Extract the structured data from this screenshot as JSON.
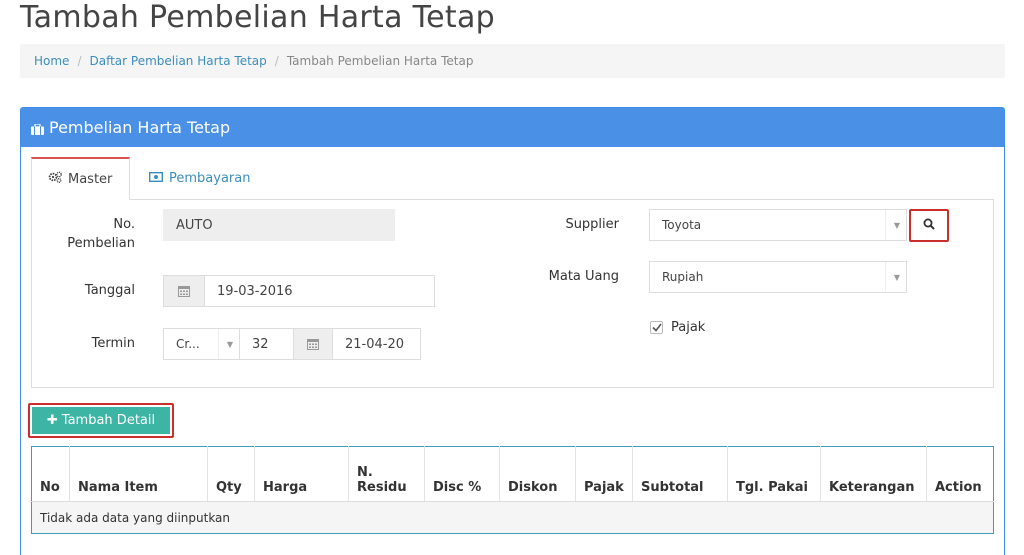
{
  "page": {
    "title": "Tambah Pembelian Harta Tetap"
  },
  "breadcrumb": {
    "home": "Home",
    "list": "Daftar Pembelian Harta Tetap",
    "current": "Tambah Pembelian Harta Tetap"
  },
  "panel": {
    "title": "Pembelian Harta Tetap",
    "tabs": [
      {
        "label": "Master",
        "icon": "gears-icon"
      },
      {
        "label": "Pembayaran",
        "icon": "money-icon"
      }
    ]
  },
  "form": {
    "no_pembelian_label_1": "No.",
    "no_pembelian_label_2": "Pembelian",
    "no_pembelian_value": "AUTO",
    "tanggal_label": "Tanggal",
    "tanggal_value": "19-03-2016",
    "termin_label": "Termin",
    "termin_type_value": "Cr...",
    "termin_days_value": "32",
    "termin_date_value": "21-04-20",
    "supplier_label": "Supplier",
    "supplier_value": "Toyota",
    "mata_uang_label": "Mata Uang",
    "mata_uang_value": "Rupiah",
    "pajak_label": "Pajak",
    "pajak_checked": true
  },
  "detail": {
    "add_button_label": "Tambah Detail",
    "columns": [
      "No",
      "Nama Item",
      "Qty",
      "Harga",
      "N. Residu",
      "Disc %",
      "Diskon",
      "Pajak",
      "Subtotal",
      "Tgl. Pakai",
      "Keterangan",
      "Action"
    ],
    "n_residu_line1": "N.",
    "n_residu_line2": "Residu",
    "empty_text": "Tidak ada data yang diinputkan"
  },
  "colors": {
    "panel_header": "#4a90e6",
    "accent_button": "#3cb5a4",
    "highlight_border": "#c9302c",
    "link": "#3c8dbc"
  }
}
